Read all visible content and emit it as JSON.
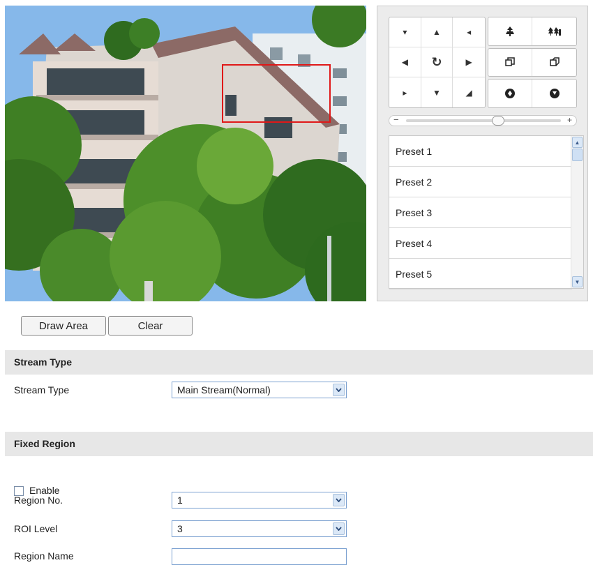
{
  "ptz": {
    "direction_buttons": [
      {
        "name": "pan-up-left",
        "icon": "arrow-up-left-icon",
        "glyph": "▾"
      },
      {
        "name": "pan-up",
        "icon": "arrow-up-icon",
        "glyph": "▲"
      },
      {
        "name": "pan-up-right",
        "icon": "arrow-up-right-icon",
        "glyph": "◂"
      },
      {
        "name": "pan-left",
        "icon": "arrow-left-icon",
        "glyph": "◀"
      },
      {
        "name": "auto-pan",
        "icon": "auto-rotate-icon",
        "glyph": "↻"
      },
      {
        "name": "pan-right",
        "icon": "arrow-right-icon",
        "glyph": "▶"
      },
      {
        "name": "pan-down-left",
        "icon": "arrow-down-left-icon",
        "glyph": "▸"
      },
      {
        "name": "pan-down",
        "icon": "arrow-down-icon",
        "glyph": "▼"
      },
      {
        "name": "pan-down-right",
        "icon": "arrow-down-right-icon",
        "glyph": "◢"
      }
    ],
    "function_buttons": [
      [
        "zoom-in-icon",
        "zoom-out-icon"
      ],
      [
        "focus-near-icon",
        "focus-far-icon"
      ],
      [
        "iris-open-icon",
        "iris-close-icon"
      ]
    ],
    "speed": {
      "min_symbol": "−",
      "max_symbol": "+",
      "level": 0.6
    },
    "presets": [
      "Preset 1",
      "Preset 2",
      "Preset 3",
      "Preset 4",
      "Preset 5"
    ]
  },
  "area_buttons": {
    "draw": "Draw Area",
    "clear": "Clear"
  },
  "stream_section": {
    "title": "Stream Type",
    "field_label": "Stream Type",
    "selected": "Main Stream(Normal)"
  },
  "fixed_region": {
    "title": "Fixed Region",
    "enable_label": "Enable",
    "enabled": false,
    "region_no_label": "Region No.",
    "region_no": "1",
    "roi_level_label": "ROI Level",
    "roi_level": "3",
    "region_name_label": "Region Name",
    "region_name": ""
  },
  "colors": {
    "roi_box": "#e01818",
    "section_bg": "#e7e7e7",
    "accent": "#7aa0d0"
  }
}
